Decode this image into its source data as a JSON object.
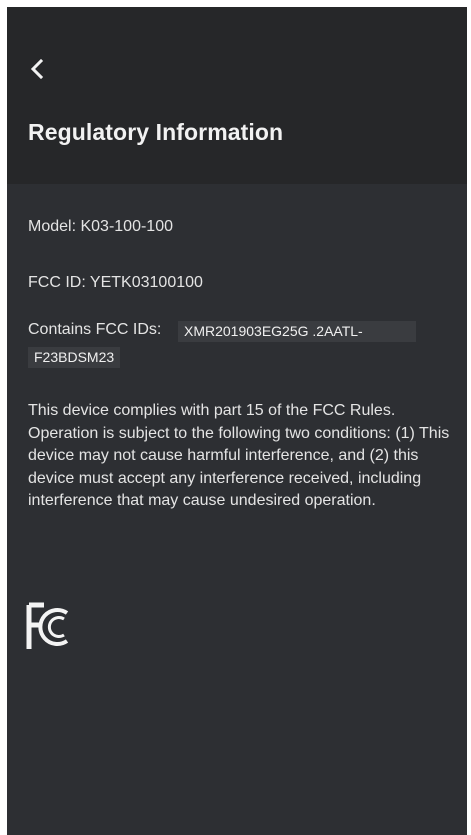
{
  "header": {
    "back_icon": "chevron-left-icon",
    "title": "Regulatory Information"
  },
  "info": {
    "model": "Model: K03-100-100",
    "fcc_id": "FCC ID: YETK03100100",
    "contains_label": "Contains FCC IDs:",
    "contains_value_1": "XMR201903EG25G .2AATL-",
    "contains_value_2": "F23BDSM23",
    "compliance_text": "This device complies with part 15 of the FCC Rules. Operation is subject to the following two conditions: (1) This device may not cause harmful interference, and (2) this device must accept any interference received, including interference that may cause undesired operation."
  },
  "logo": {
    "name": "fcc-logo",
    "text": "FC"
  },
  "colors": {
    "header_bg": "#262729",
    "content_bg": "#2d2f33",
    "text": "#e4e4e4",
    "chip_bg": "#3a3c40"
  }
}
